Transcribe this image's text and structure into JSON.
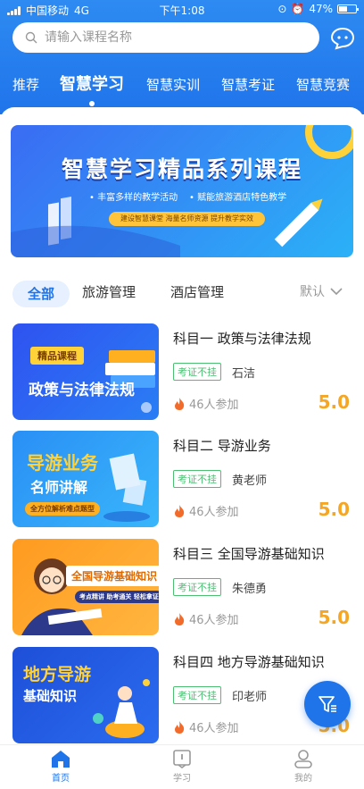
{
  "status_bar": {
    "carrier": "中国移动",
    "network": "4G",
    "time": "下午1:08",
    "battery": "47%"
  },
  "search": {
    "placeholder": "请输入课程名称"
  },
  "top_tabs": [
    "推荐",
    "智慧学习",
    "智慧实训",
    "智慧考证",
    "智慧竞赛"
  ],
  "active_tab_index": 1,
  "banner": {
    "title": "智慧学习精品系列课程",
    "sub_left": "丰富多样的教学活动",
    "sub_right": "赋能旅游酒店特色教学",
    "pill": "建设智慧课堂  海量名师资源  提升教学实效"
  },
  "filters": {
    "items": [
      "全部",
      "旅游管理",
      "酒店管理"
    ],
    "sort": "默认"
  },
  "courses": [
    {
      "title": "科目一 政策与法律法规",
      "badge": "考证不挂",
      "teacher": "石洁",
      "joined": "46人参加",
      "score": "5.0",
      "thumb_lines": [
        "精品课程",
        "政策与法律法规"
      ]
    },
    {
      "title": "科目二 导游业务",
      "badge": "考证不挂",
      "teacher": "黄老师",
      "joined": "46人参加",
      "score": "5.0",
      "thumb_lines": [
        "导游业务",
        "名师讲解",
        "全方位解析难点题型"
      ]
    },
    {
      "title": "科目三 全国导游基础知识",
      "badge": "考证不挂",
      "teacher": "朱德勇",
      "joined": "46人参加",
      "score": "5.0",
      "thumb_lines": [
        "全国导游基础知识",
        "考点精讲 助考通关 轻松拿证"
      ]
    },
    {
      "title": "科目四 地方导游基础知识",
      "badge": "考证不挂",
      "teacher": "印老师",
      "joined": "46人参加",
      "score": "5.0",
      "thumb_lines": [
        "地方导游",
        "基础知识"
      ]
    }
  ],
  "bottom_nav": [
    {
      "label": "首页",
      "icon": "home-icon"
    },
    {
      "label": "学习",
      "icon": "book-icon"
    },
    {
      "label": "我的",
      "icon": "profile-icon"
    }
  ],
  "colors": {
    "primary": "#1f74ea",
    "score": "#f5a623",
    "badge": "#4cbf73"
  }
}
